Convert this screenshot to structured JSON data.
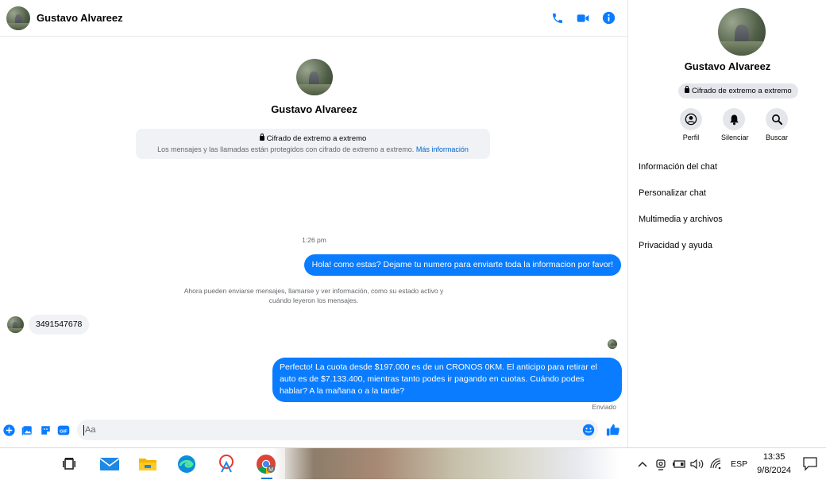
{
  "contact": {
    "name": "Gustavo Alvareez"
  },
  "colors": {
    "accent": "#0a7cff",
    "brand_blue": "#0064d1",
    "bubble_in": "#f0f2f5"
  },
  "header": {
    "icons": [
      "phone-icon",
      "video-camera-icon",
      "info-icon"
    ]
  },
  "encryption": {
    "title": "Cifrado de extremo a extremo",
    "description": "Los mensajes y las llamadas están protegidos con cifrado de extremo a extremo.",
    "link": "Más información"
  },
  "messages": {
    "timestamp": "1:26 pm",
    "outgoing_1": "Hola! como estas? Dejame tu numero para enviarte toda la informacion por favor!",
    "system_note": "Ahora pueden enviarse mensajes, llamarse y ver información, como su estado activo y cuándo leyeron los mensajes.",
    "incoming_1": "3491547678",
    "outgoing_2": "Perfecto! La cuota desde $197.000 es de un CRONOS 0KM. El anticipo para retirar el auto es de $7.133.400, mientras tanto podes ir pagando en cuotas. Cuándo podes hablar? A la mañana o a la tarde?",
    "status": "Enviado"
  },
  "composer": {
    "placeholder": "Aa"
  },
  "info_panel": {
    "badge": "Cifrado de extremo a extremo",
    "actions": {
      "profile": "Perfil",
      "mute": "Silenciar",
      "search": "Buscar"
    },
    "menu": {
      "chat_info": "Información del chat",
      "customize": "Personalizar chat",
      "media": "Multimedia y archivos",
      "privacy": "Privacidad y ayuda"
    }
  },
  "taskbar": {
    "apps": [
      "task-view-icon",
      "mail-icon",
      "file-explorer-icon",
      "edge-icon",
      "snip-icon",
      "chrome-icon"
    ],
    "language": "ESP",
    "time": "13:35",
    "date": "9/8/2024"
  }
}
